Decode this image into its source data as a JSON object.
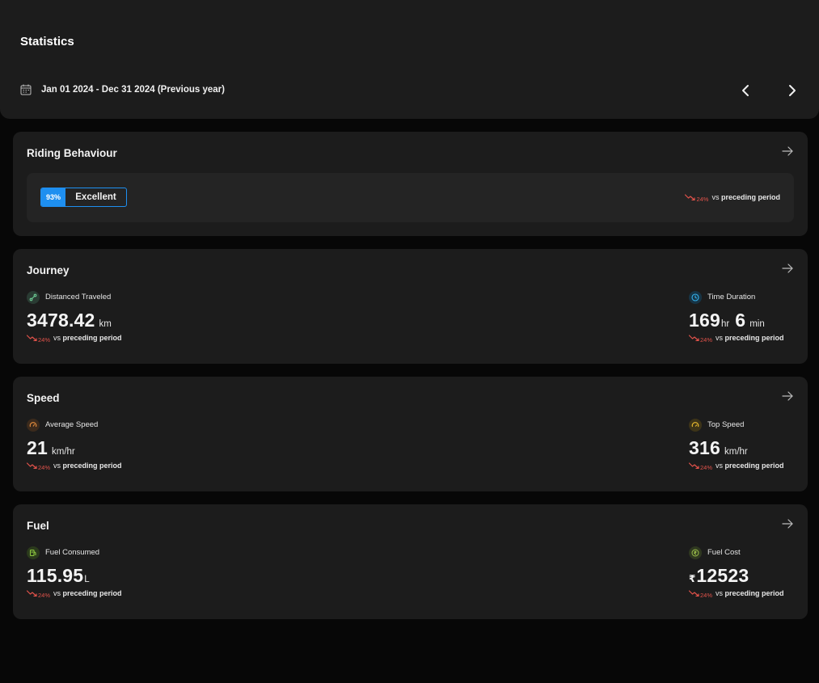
{
  "header": {
    "title": "Statistics",
    "date_range": "Jan 01 2024 - Dec 31 2024 (Previous year)"
  },
  "trend": {
    "pct": "24%",
    "vs": "vs",
    "text": "preceding period"
  },
  "riding": {
    "title": "Riding Behaviour",
    "score": "93%",
    "rating": "Excellent"
  },
  "journey": {
    "title": "Journey",
    "distance": {
      "label": "Distanced Traveled",
      "value": "3478.42",
      "unit": "km"
    },
    "duration": {
      "label": "Time Duration",
      "hours": "169",
      "hours_unit": "hr",
      "minutes": "6",
      "minutes_unit": "min"
    }
  },
  "speed": {
    "title": "Speed",
    "average": {
      "label": "Average Speed",
      "value": "21",
      "unit": "km/hr"
    },
    "top": {
      "label": "Top Speed",
      "value": "316",
      "unit": "km/hr"
    }
  },
  "fuel": {
    "title": "Fuel",
    "consumed": {
      "label": "Fuel Consumed",
      "value": "115.95",
      "unit": "L"
    },
    "cost": {
      "label": "Fuel Cost",
      "currency": "₹",
      "value": "12523"
    }
  },
  "colors": {
    "background": "#070707",
    "card": "#1c1c1c",
    "accent": "#1e8ff0",
    "trend_down": "#e0524a"
  },
  "icons": {
    "date": "calendar-icon",
    "prev": "chevron-left-icon",
    "next": "chevron-right-icon",
    "card_link": "arrow-right-icon",
    "trend": "trending-down-icon",
    "distance": "route-icon",
    "duration": "clock-icon",
    "average_speed": "speedometer-icon",
    "top_speed": "gauge-icon",
    "fuel_consumed": "fuel-pump-icon",
    "fuel_cost": "rupee-icon"
  }
}
